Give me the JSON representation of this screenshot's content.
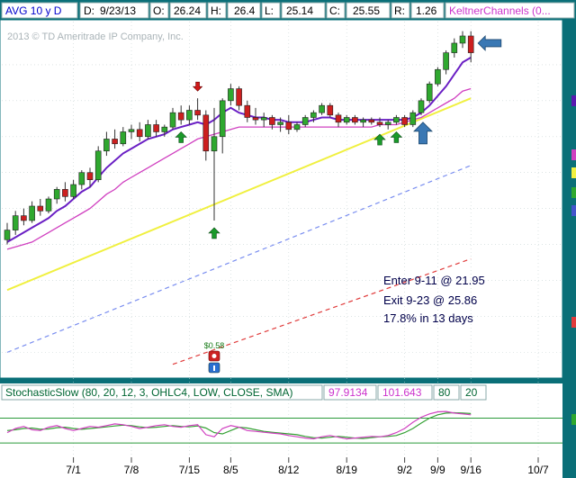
{
  "header": {
    "symbol": "AVG 10 y D",
    "date_label": "D:",
    "date_value": "9/23/13",
    "open_label": "O:",
    "open_value": "26.24",
    "high_label": "H:",
    "high_value": "26.4",
    "low_label": "L:",
    "low_value": "25.14",
    "close_label": "C:",
    "close_value": "25.55",
    "range_label": "R:",
    "range_value": "1.26",
    "study_label": "KeltnerChannels (0..."
  },
  "watermark": "2013 © TD Ameritrade IP Company, Inc.",
  "annotation": {
    "line1": "Enter 9-11 @ 21.95",
    "line2": "Exit 9-23 @ 25.86",
    "line3": "17.8% in 13 days"
  },
  "event_label": "$0.58",
  "stochastic": {
    "label": "StochasticSlow (80, 20, 12, 3, OHLC4, LOW, CLOSE, SMA)",
    "k_value": "97.9134",
    "d_value": "101.643",
    "upper": "80",
    "lower": "20"
  },
  "chart_data": {
    "type": "candlestick",
    "x_tick_labels": [
      "7/1",
      "7/8",
      "7/15",
      "8/5",
      "8/12",
      "8/19",
      "9/2",
      "9/9",
      "9/16",
      "10/7"
    ],
    "colors": {
      "up": "#2fa82f",
      "down": "#cc1f1f",
      "ema_fast": "#6a1fc4",
      "keltner_mid": "#d040c0",
      "sma_50": "#f0f040",
      "trend_blue": "#7a8ef0",
      "trend_red": "#e03c3c",
      "stoch_k": "#d040c0",
      "stoch_d": "#33a033",
      "buy_arrow": "#1a9a2a",
      "sell_arrow": "#d01818",
      "highlight_arrow": "#3a78b4"
    },
    "candles": [
      {
        "o": 17.7,
        "h": 18.4,
        "l": 17.5,
        "c": 18.1
      },
      {
        "o": 18.1,
        "h": 18.9,
        "l": 17.9,
        "c": 18.7
      },
      {
        "o": 18.7,
        "h": 19.0,
        "l": 18.3,
        "c": 18.5
      },
      {
        "o": 18.5,
        "h": 19.3,
        "l": 18.4,
        "c": 19.1
      },
      {
        "o": 19.1,
        "h": 19.4,
        "l": 18.7,
        "c": 18.9
      },
      {
        "o": 18.9,
        "h": 19.5,
        "l": 18.8,
        "c": 19.4
      },
      {
        "o": 19.4,
        "h": 19.9,
        "l": 19.2,
        "c": 19.8
      },
      {
        "o": 19.8,
        "h": 20.1,
        "l": 19.3,
        "c": 19.5
      },
      {
        "o": 19.5,
        "h": 20.2,
        "l": 19.4,
        "c": 20.0
      },
      {
        "o": 20.0,
        "h": 20.6,
        "l": 19.8,
        "c": 20.5
      },
      {
        "o": 20.5,
        "h": 20.7,
        "l": 19.9,
        "c": 20.2
      },
      {
        "o": 20.2,
        "h": 21.6,
        "l": 20.1,
        "c": 21.4
      },
      {
        "o": 21.4,
        "h": 22.2,
        "l": 21.2,
        "c": 21.9
      },
      {
        "o": 21.9,
        "h": 22.3,
        "l": 21.5,
        "c": 21.7
      },
      {
        "o": 21.7,
        "h": 22.4,
        "l": 21.6,
        "c": 22.2
      },
      {
        "o": 22.2,
        "h": 22.5,
        "l": 21.9,
        "c": 22.3
      },
      {
        "o": 22.3,
        "h": 22.6,
        "l": 21.8,
        "c": 22.0
      },
      {
        "o": 22.0,
        "h": 22.7,
        "l": 21.9,
        "c": 22.5
      },
      {
        "o": 22.5,
        "h": 22.7,
        "l": 22.0,
        "c": 22.2
      },
      {
        "o": 22.2,
        "h": 22.5,
        "l": 22.0,
        "c": 22.4
      },
      {
        "o": 22.4,
        "h": 23.2,
        "l": 22.3,
        "c": 23.0
      },
      {
        "o": 23.0,
        "h": 23.3,
        "l": 22.5,
        "c": 22.7
      },
      {
        "o": 22.7,
        "h": 23.3,
        "l": 22.5,
        "c": 23.1
      },
      {
        "o": 23.1,
        "h": 23.6,
        "l": 22.7,
        "c": 22.9
      },
      {
        "o": 22.9,
        "h": 23.1,
        "l": 21.0,
        "c": 21.4
      },
      {
        "o": 21.4,
        "h": 23.2,
        "l": 18.5,
        "c": 22.0
      },
      {
        "o": 22.0,
        "h": 23.6,
        "l": 21.3,
        "c": 23.5
      },
      {
        "o": 23.5,
        "h": 24.2,
        "l": 23.3,
        "c": 24.0
      },
      {
        "o": 24.0,
        "h": 24.1,
        "l": 23.1,
        "c": 23.3
      },
      {
        "o": 23.3,
        "h": 23.5,
        "l": 22.6,
        "c": 22.8
      },
      {
        "o": 22.8,
        "h": 23.2,
        "l": 22.5,
        "c": 22.7
      },
      {
        "o": 22.7,
        "h": 23.0,
        "l": 22.4,
        "c": 22.8
      },
      {
        "o": 22.8,
        "h": 22.9,
        "l": 22.3,
        "c": 22.5
      },
      {
        "o": 22.5,
        "h": 22.8,
        "l": 22.2,
        "c": 22.6
      },
      {
        "o": 22.6,
        "h": 22.9,
        "l": 22.1,
        "c": 22.3
      },
      {
        "o": 22.3,
        "h": 22.6,
        "l": 22.2,
        "c": 22.5
      },
      {
        "o": 22.5,
        "h": 22.9,
        "l": 22.4,
        "c": 22.8
      },
      {
        "o": 22.8,
        "h": 23.1,
        "l": 22.6,
        "c": 23.0
      },
      {
        "o": 23.0,
        "h": 23.4,
        "l": 22.9,
        "c": 23.3
      },
      {
        "o": 23.3,
        "h": 23.4,
        "l": 22.8,
        "c": 22.9
      },
      {
        "o": 22.9,
        "h": 23.0,
        "l": 22.4,
        "c": 22.6
      },
      {
        "o": 22.6,
        "h": 22.9,
        "l": 22.5,
        "c": 22.8
      },
      {
        "o": 22.8,
        "h": 22.9,
        "l": 22.5,
        "c": 22.6
      },
      {
        "o": 22.6,
        "h": 22.8,
        "l": 22.4,
        "c": 22.7
      },
      {
        "o": 22.7,
        "h": 22.8,
        "l": 22.5,
        "c": 22.6
      },
      {
        "o": 22.6,
        "h": 22.8,
        "l": 22.4,
        "c": 22.5
      },
      {
        "o": 22.5,
        "h": 22.7,
        "l": 22.3,
        "c": 22.6
      },
      {
        "o": 22.6,
        "h": 22.9,
        "l": 22.5,
        "c": 22.8
      },
      {
        "o": 22.8,
        "h": 22.9,
        "l": 22.4,
        "c": 22.5
      },
      {
        "o": 22.5,
        "h": 23.1,
        "l": 22.4,
        "c": 23.0
      },
      {
        "o": 23.0,
        "h": 23.6,
        "l": 22.9,
        "c": 23.5
      },
      {
        "o": 23.5,
        "h": 24.3,
        "l": 23.4,
        "c": 24.2
      },
      {
        "o": 24.2,
        "h": 24.9,
        "l": 24.1,
        "c": 24.8
      },
      {
        "o": 24.8,
        "h": 25.6,
        "l": 24.6,
        "c": 25.5
      },
      {
        "o": 25.5,
        "h": 26.1,
        "l": 25.3,
        "c": 25.9
      },
      {
        "o": 25.9,
        "h": 26.4,
        "l": 25.7,
        "c": 26.2
      },
      {
        "o": 26.2,
        "h": 26.4,
        "l": 25.1,
        "c": 25.5
      }
    ],
    "ema_fast": [
      17.6,
      17.8,
      18.0,
      18.2,
      18.4,
      18.6,
      18.9,
      19.1,
      19.4,
      19.7,
      19.9,
      20.3,
      20.7,
      21.0,
      21.3,
      21.5,
      21.7,
      21.9,
      22.0,
      22.1,
      22.3,
      22.4,
      22.5,
      22.6,
      22.5,
      22.7,
      23.0,
      23.2,
      23.0,
      22.9,
      22.8,
      22.8,
      22.7,
      22.7,
      22.6,
      22.6,
      22.6,
      22.7,
      22.8,
      22.8,
      22.7,
      22.7,
      22.7,
      22.7,
      22.7,
      22.7,
      22.7,
      22.7,
      22.7,
      22.8,
      23.0,
      23.3,
      23.7,
      24.1,
      24.6,
      25.1,
      25.3
    ],
    "keltner_mid": [
      17.3,
      17.4,
      17.5,
      17.6,
      17.8,
      18.0,
      18.2,
      18.4,
      18.6,
      18.8,
      19.0,
      19.3,
      19.6,
      19.8,
      20.1,
      20.3,
      20.5,
      20.7,
      20.9,
      21.1,
      21.3,
      21.5,
      21.7,
      21.9,
      22.0,
      22.1,
      22.2,
      22.3,
      22.4,
      22.4,
      22.4,
      22.4,
      22.4,
      22.4,
      22.4,
      22.4,
      22.4,
      22.4,
      22.4,
      22.4,
      22.4,
      22.4,
      22.4,
      22.4,
      22.4,
      22.5,
      22.5,
      22.5,
      22.6,
      22.7,
      22.8,
      23.0,
      23.2,
      23.4,
      23.6,
      23.9,
      24.0
    ],
    "sma_50_start": [
      0,
      15.6
    ],
    "sma_50_end": [
      56,
      23.6
    ],
    "trend_blue_start": [
      9,
      13.3
    ],
    "trend_blue_end": [
      56,
      20.8
    ],
    "trend_red_start": [
      29,
      13.1
    ],
    "trend_red_end": [
      56,
      16.9
    ],
    "buy_arrow_bars": [
      21,
      25,
      45,
      47
    ],
    "sell_arrow_bars": [
      23
    ],
    "highlight_up_bar": 50,
    "highlight_left_bar": 56,
    "event_bar": 25,
    "stoch_k": [
      45,
      55,
      60,
      52,
      50,
      58,
      62,
      55,
      50,
      55,
      60,
      58,
      62,
      66,
      64,
      60,
      55,
      58,
      62,
      64,
      60,
      58,
      62,
      64,
      40,
      35,
      55,
      62,
      58,
      50,
      48,
      46,
      44,
      42,
      38,
      35,
      32,
      30,
      35,
      38,
      34,
      30,
      32,
      34,
      36,
      35,
      38,
      45,
      55,
      70,
      82,
      90,
      95,
      96,
      92,
      90,
      88
    ],
    "stoch_d": [
      50,
      52,
      55,
      56,
      53,
      54,
      57,
      58,
      55,
      53,
      55,
      57,
      59,
      61,
      63,
      62,
      59,
      57,
      58,
      60,
      62,
      60,
      59,
      61,
      56,
      45,
      42,
      50,
      58,
      56,
      52,
      48,
      46,
      44,
      42,
      40,
      36,
      33,
      32,
      34,
      36,
      34,
      32,
      31,
      33,
      35,
      36,
      38,
      45,
      55,
      68,
      80,
      88,
      92,
      93,
      92,
      91
    ],
    "y_range": [
      12.0,
      26.8
    ],
    "stoch_range": [
      -10,
      120
    ]
  }
}
